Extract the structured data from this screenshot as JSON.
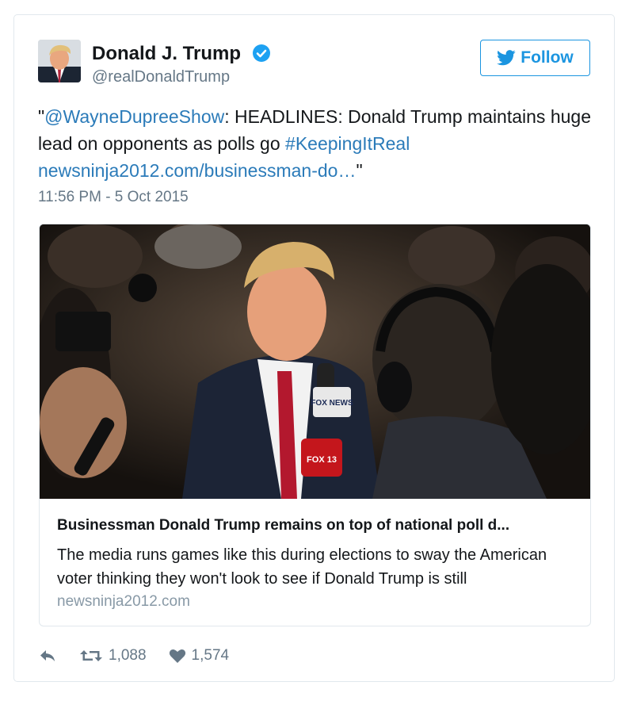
{
  "user": {
    "name": "Donald J. Trump",
    "handle": "@realDonaldTrump",
    "verified": true,
    "avatar_icon": "profile-photo"
  },
  "follow_button": {
    "label": "Follow",
    "icon": "twitter-bird-icon"
  },
  "tweet": {
    "open_quote": "\"",
    "mention": "@WayneDupreeShow",
    "text_part1": ": HEADLINES: Donald Trump maintains huge lead on opponents as polls go ",
    "hashtag": "#KeepingItReal",
    "link": "newsninja2012.com/businessman-do…",
    "close_quote": "\"",
    "timestamp": "11:56 PM - 5 Oct 2015"
  },
  "media_card": {
    "image_alt": "press photo with microphones",
    "title": "Businessman Donald Trump remains on top of national poll d...",
    "description": "The media runs games like this during elections to sway the American voter thinking they won't look to see if Donald Trump is still",
    "domain": "newsninja2012.com",
    "mic_labels": [
      "FOX NEWS",
      "FOX 13"
    ]
  },
  "actions": {
    "reply_icon": "reply-icon",
    "retweet_icon": "retweet-icon",
    "retweet_count": "1,088",
    "like_icon": "heart-icon",
    "like_count": "1,574"
  },
  "colors": {
    "link": "#2b7bb9",
    "follow": "#1b95e0",
    "verified": "#1da1f2",
    "secondary_text": "#657786"
  }
}
